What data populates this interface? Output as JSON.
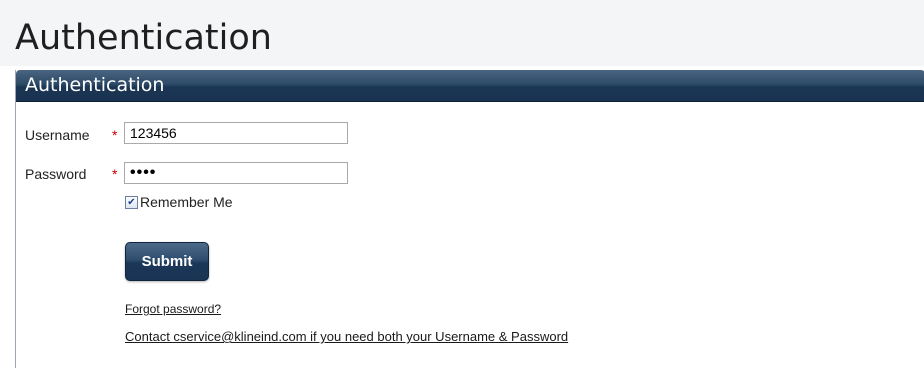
{
  "page": {
    "title": "Authentication"
  },
  "panel": {
    "header": "Authentication"
  },
  "form": {
    "username_label": "Username",
    "password_label": "Password",
    "required_marker": "*",
    "username_value": "123456",
    "password_value": "••••",
    "remember_label": "Remember Me",
    "remember_checked": true,
    "submit_label": "Submit",
    "forgot_link": "Forgot password?",
    "contact_text": "Contact cservice@klineind.com if you need both your Username & Password"
  },
  "colors": {
    "header_bg": "#1b3654",
    "required": "#cc0000"
  }
}
